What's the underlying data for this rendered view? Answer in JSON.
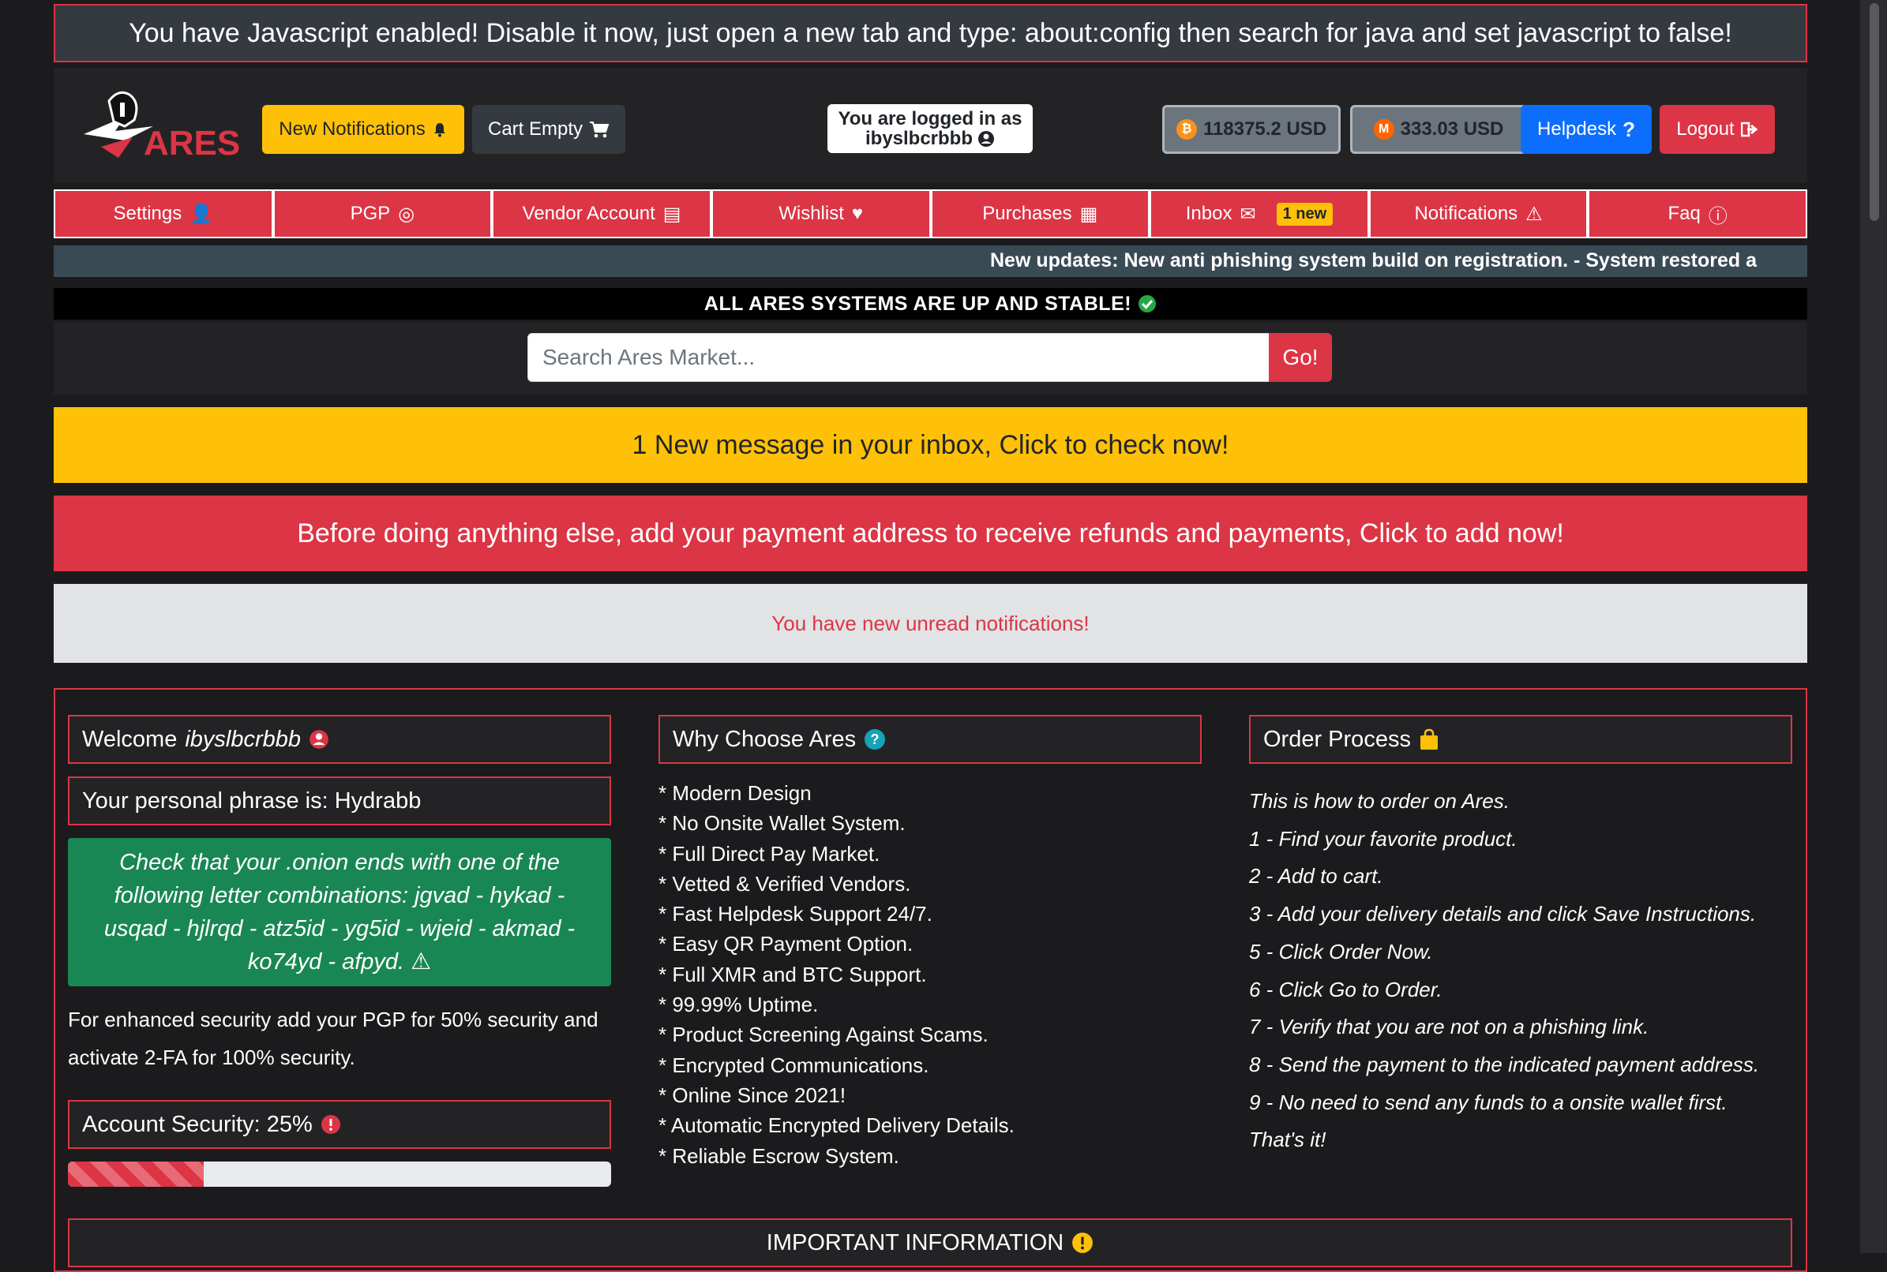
{
  "js_warning": "You have Javascript enabled! Disable it now, just open a new tab and type: about:config then search for java and set javascript to false!",
  "header": {
    "logo_text": "ARES",
    "notifications_button": "New Notifications",
    "cart_button": "Cart Empty",
    "logged_in_label": "You are logged in as",
    "username": "ibyslbcrbbb",
    "btc_balance": "118375.2 USD",
    "xmr_balance": "333.03 USD",
    "helpdesk_button": "Helpdesk",
    "logout_button": "Logout"
  },
  "nav": [
    {
      "label": "Settings",
      "icon": "user-cog-icon"
    },
    {
      "label": "PGP",
      "icon": "fingerprint-icon"
    },
    {
      "label": "Vendor Account",
      "icon": "id-card-icon"
    },
    {
      "label": "Wishlist",
      "icon": "heart-icon"
    },
    {
      "label": "Purchases",
      "icon": "cash-register-icon"
    },
    {
      "label": "Inbox",
      "icon": "inbox-icon",
      "badge": "1 new"
    },
    {
      "label": "Notifications",
      "icon": "warning-icon"
    },
    {
      "label": "Faq",
      "icon": "info-icon"
    }
  ],
  "ticker": "New updates: New anti phishing system build on registration. -  System restored a",
  "status_banner": "ALL ARES SYSTEMS ARE UP AND STABLE!",
  "search": {
    "placeholder": "Search Ares Market...",
    "button": "Go!"
  },
  "alerts": {
    "message": "1 New message in your inbox, Click to check now!",
    "payment": "Before doing anything else, add your payment address to receive refunds and payments, Click to add now!",
    "notifications": "You have new unread notifications!"
  },
  "left": {
    "welcome_prefix": "Welcome",
    "welcome_user": "ibyslbcrbbb",
    "phrase": "Your personal phrase is: Hydrabb",
    "onion_check": "Check that your .onion ends with one of the following letter combinations: jgvad - hykad - usqad - hjlrqd - atz5id - yg5id - wjeid - akmad - ko74yd - afpyd.",
    "security_note": "For enhanced security add your PGP for 50% security and activate 2-FA for 100% security.",
    "account_security": "Account Security: 25%",
    "security_percent": 25
  },
  "why": {
    "title": "Why Choose Ares",
    "items": [
      "* Modern Design",
      "* No Onsite Wallet System.",
      "* Full Direct Pay Market.",
      "* Vetted & Verified Vendors.",
      "* Fast Helpdesk Support 24/7.",
      "* Easy QR Payment Option.",
      "* Full XMR and BTC Support.",
      "* 99.99% Uptime.",
      "* Product Screening Against Scams.",
      "* Encrypted Communications.",
      "* Online Since 2021!",
      "* Automatic Encrypted Delivery Details.",
      "* Reliable Escrow System."
    ]
  },
  "order": {
    "title": "Order Process",
    "items": [
      "This is how to order on Ares.",
      "1 - Find your favorite product.",
      "2 - Add to cart.",
      "3 - Add your delivery details and click Save Instructions.",
      "5 - Click Order Now.",
      "6 - Click Go to Order.",
      "7 - Verify that you are not on a phishing link.",
      "8 - Send the payment to the indicated payment address.",
      "9 - No need to send any funds to a onsite wallet first.",
      "That's it!"
    ]
  },
  "important": "IMPORTANT INFORMATION",
  "colors": {
    "red": "#dc3545",
    "yellow": "#ffc107",
    "blue": "#0d6efd",
    "green": "#198754",
    "dark": "#1b1b1d"
  }
}
